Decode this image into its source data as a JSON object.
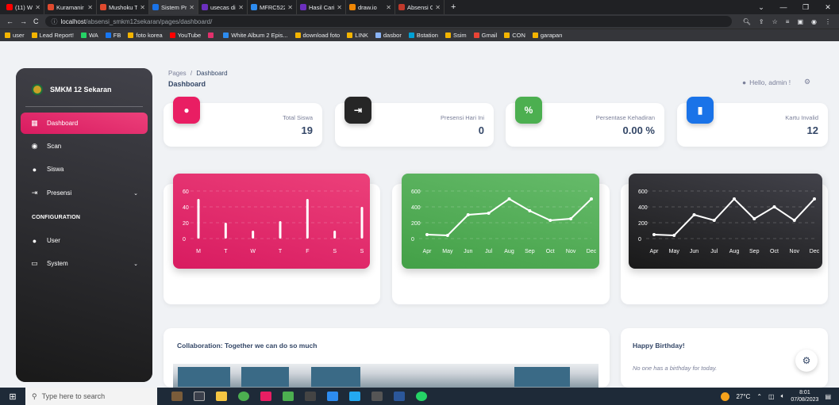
{
  "browser": {
    "tabs": [
      {
        "label": "(11) W",
        "color": "#ff0000"
      },
      {
        "label": "Kuramanir",
        "color": "#e04a2e"
      },
      {
        "label": "Mushoku T",
        "color": "#e04a2e"
      },
      {
        "label": "Sistem Pre",
        "color": "#1a73e8"
      },
      {
        "label": "usecas dia",
        "color": "#6b2fbf"
      },
      {
        "label": "MFRC522",
        "color": "#2d8cf0"
      },
      {
        "label": "Hasil Cari",
        "color": "#6b2fbf"
      },
      {
        "label": "draw.io",
        "color": "#f08705"
      },
      {
        "label": "Absensi O",
        "color": "#c0392b"
      }
    ],
    "active_tab_index": 3,
    "url_host": "localhost",
    "url_path": "/absensi_smkm12sekaran/pages/dashboard/",
    "bookmarks": [
      {
        "label": "user",
        "color": "#f4b400"
      },
      {
        "label": "Lead Report!",
        "color": "#f4b400"
      },
      {
        "label": "WA",
        "color": "#25d366"
      },
      {
        "label": "FB",
        "color": "#1877f2"
      },
      {
        "label": "foto korea",
        "color": "#f4b400"
      },
      {
        "label": "YouTube",
        "color": "#ff0000"
      },
      {
        "label": "",
        "color": "#e1306c"
      },
      {
        "label": "White Album 2 Epis...",
        "color": "#2d8cf0"
      },
      {
        "label": "download foto",
        "color": "#f4b400"
      },
      {
        "label": "LINK",
        "color": "#f4b400"
      },
      {
        "label": "dasbor",
        "color": "#8ab4f8"
      },
      {
        "label": "Bstation",
        "color": "#00a1d6"
      },
      {
        "label": "Ssim",
        "color": "#f4b400"
      },
      {
        "label": "Gmail",
        "color": "#ea4335"
      },
      {
        "label": "CON",
        "color": "#f4b400"
      },
      {
        "label": "garapan",
        "color": "#f4b400"
      }
    ]
  },
  "sidebar": {
    "brand": "SMKM 12 Sekaran",
    "items": [
      {
        "label": "Dashboard",
        "icon": "dashboard-icon",
        "glyph": "▦"
      },
      {
        "label": "Scan",
        "icon": "scan-icon",
        "glyph": "◉"
      },
      {
        "label": "Siswa",
        "icon": "person-icon",
        "glyph": "●"
      },
      {
        "label": "Presensi",
        "icon": "login-icon",
        "glyph": "⇥"
      }
    ],
    "config_heading": "CONFIGURATION",
    "config_items": [
      {
        "label": "User",
        "icon": "users-icon",
        "glyph": "●"
      },
      {
        "label": "System",
        "icon": "monitor-icon",
        "glyph": "▭"
      }
    ]
  },
  "header": {
    "breadcrumb_root": "Pages",
    "breadcrumb_sep": "/",
    "breadcrumb_current": "Dashboard",
    "title": "Dashboard",
    "greeting": "Hello, admin !"
  },
  "stats": [
    {
      "label": "Total Siswa",
      "value": "19",
      "color": "#e91e63",
      "glyph": "●"
    },
    {
      "label": "Presensi Hari Ini",
      "value": "0",
      "color": "#262626",
      "glyph": "⇥"
    },
    {
      "label": "Persentase Kehadiran",
      "value": "0.00 %",
      "color": "#4caf50",
      "glyph": "%"
    },
    {
      "label": "Kartu Invalid",
      "value": "12",
      "color": "#1a73e8",
      "glyph": "▮"
    }
  ],
  "chart_data": [
    {
      "type": "bar",
      "categories": [
        "M",
        "T",
        "W",
        "T",
        "F",
        "S",
        "S"
      ],
      "values": [
        50,
        20,
        10,
        22,
        50,
        10,
        40
      ],
      "ylim": [
        0,
        60
      ],
      "yticks": [
        "0",
        "20",
        "40",
        "60"
      ],
      "background": "#e91e63"
    },
    {
      "type": "line",
      "categories": [
        "Apr",
        "May",
        "Jun",
        "Jul",
        "Aug",
        "Sep",
        "Oct",
        "Nov",
        "Dec"
      ],
      "values": [
        50,
        40,
        300,
        320,
        500,
        350,
        230,
        250,
        500
      ],
      "ylim": [
        0,
        600
      ],
      "yticks": [
        "0",
        "200",
        "400",
        "600"
      ],
      "background": "#4caf50"
    },
    {
      "type": "line",
      "categories": [
        "Apr",
        "May",
        "Jun",
        "Jul",
        "Aug",
        "Sep",
        "Oct",
        "Nov",
        "Dec"
      ],
      "values": [
        50,
        40,
        300,
        230,
        500,
        250,
        400,
        230,
        500
      ],
      "ylim": [
        0,
        600
      ],
      "yticks": [
        "0",
        "200",
        "400",
        "600"
      ],
      "background": "#262626"
    }
  ],
  "sections": {
    "collab_title": "Collaboration: Together we can do so much",
    "birthday_title": "Happy Birthday!",
    "birthday_note": "No one has a birthday for today."
  },
  "taskbar": {
    "search_placeholder": "Type here to search",
    "temperature": "27°C",
    "time": "8:01",
    "date": "07/08/2023"
  }
}
